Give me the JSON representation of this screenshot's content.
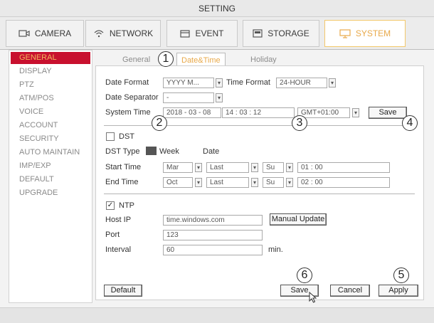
{
  "window": {
    "title": "SETTING"
  },
  "tabs": [
    {
      "label": "CAMERA",
      "icon": "camera-icon"
    },
    {
      "label": "NETWORK",
      "icon": "wifi-icon"
    },
    {
      "label": "EVENT",
      "icon": "event-icon"
    },
    {
      "label": "STORAGE",
      "icon": "storage-icon"
    },
    {
      "label": "SYSTEM",
      "icon": "monitor-icon",
      "active": true
    }
  ],
  "sidebar": {
    "items": [
      {
        "label": "GENERAL",
        "active": true
      },
      {
        "label": "DISPLAY"
      },
      {
        "label": "PTZ"
      },
      {
        "label": "ATM/POS"
      },
      {
        "label": "VOICE"
      },
      {
        "label": "ACCOUNT"
      },
      {
        "label": "SECURITY"
      },
      {
        "label": "AUTO MAINTAIN"
      },
      {
        "label": "IMP/EXP"
      },
      {
        "label": "DEFAULT"
      },
      {
        "label": "UPGRADE"
      }
    ]
  },
  "subtabs": [
    {
      "label": "General"
    },
    {
      "label": "Date&Time",
      "active": true
    },
    {
      "label": "Holiday"
    }
  ],
  "datetime": {
    "date_format_label": "Date Format",
    "date_format_value": "YYYY M...",
    "time_format_label": "Time Format",
    "time_format_value": "24-HOUR",
    "date_separator_label": "Date Separator",
    "date_separator_value": "-",
    "system_time_label": "System Time",
    "system_date_value": "2018 - 03 - 08",
    "system_clock_value": "14 : 03 : 12",
    "timezone_value": "GMT+01:00",
    "save_label": "Save"
  },
  "dst": {
    "label": "DST",
    "checked": false,
    "type_label": "DST Type",
    "type_week": "Week",
    "type_date": "Date",
    "start_label": "Start Time",
    "start_month": "Mar",
    "start_week": "Last",
    "start_day": "Su",
    "start_time": "01 : 00",
    "end_label": "End Time",
    "end_month": "Oct",
    "end_week": "Last",
    "end_day": "Su",
    "end_time": "02 : 00"
  },
  "ntp": {
    "label": "NTP",
    "checked": true,
    "host_label": "Host IP",
    "host_value": "time.windows.com",
    "manual_update_label": "Manual Update",
    "port_label": "Port",
    "port_value": "123",
    "interval_label": "Interval",
    "interval_value": "60",
    "interval_unit": "min."
  },
  "footer_buttons": {
    "default_label": "Default",
    "save_label": "Save",
    "cancel_label": "Cancel",
    "apply_label": "Apply"
  },
  "callouts": [
    "1",
    "2",
    "3",
    "4",
    "5",
    "6"
  ],
  "colors": {
    "accent": "#e8a94a",
    "active_sidebar_bg": "#c8102e",
    "panel_bg": "#ffffff"
  }
}
